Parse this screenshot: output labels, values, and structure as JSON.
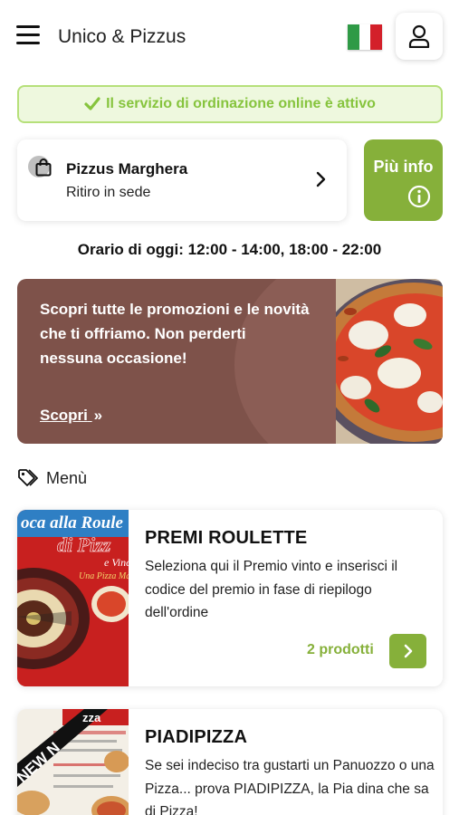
{
  "header": {
    "title": "Unico & Pizzus",
    "flag_colors": [
      "#2f9a46",
      "#ffffff",
      "#d3202a"
    ]
  },
  "service_banner": {
    "text": "Il servizio di ordinazione online è attivo",
    "icon": "check-icon",
    "color": "#86c43d"
  },
  "store": {
    "name": "Pizzus Marghera",
    "mode": "Ritiro in sede",
    "info_label": "Più info"
  },
  "hours": "Orario di oggi: 12:00 - 14:00, 18:00 - 22:00",
  "promo": {
    "text": "Scopri tutte le promozioni e le novità che ti offriamo. Non perderti nessuna occasione!",
    "link_label": "Scopri",
    "link_arrow": "»"
  },
  "menu": {
    "heading": "Menù",
    "products": [
      {
        "name": "PREMI ROULETTE",
        "description": "Seleziona qui il Premio vinto e inserisci il codice del premio in fase di riepilogo dell'ordine",
        "count_label": "2 prodotti",
        "thumb_text": "oca alla Roule",
        "thumb_text2": "di Pizz",
        "thumb_text3": "e Vinci",
        "thumb_text4": "Una Pizza Ma"
      },
      {
        "name": "PIADIPIZZA",
        "description": "Se sei indeciso tra gustarti un Panuozzo o una Pizza... prova PIADIPIZZA, la Pia dina che sa di Pizza!",
        "thumb_ribbon": "NEW N",
        "thumb_header": "zza"
      }
    ]
  },
  "accent_color": "#86b03a"
}
